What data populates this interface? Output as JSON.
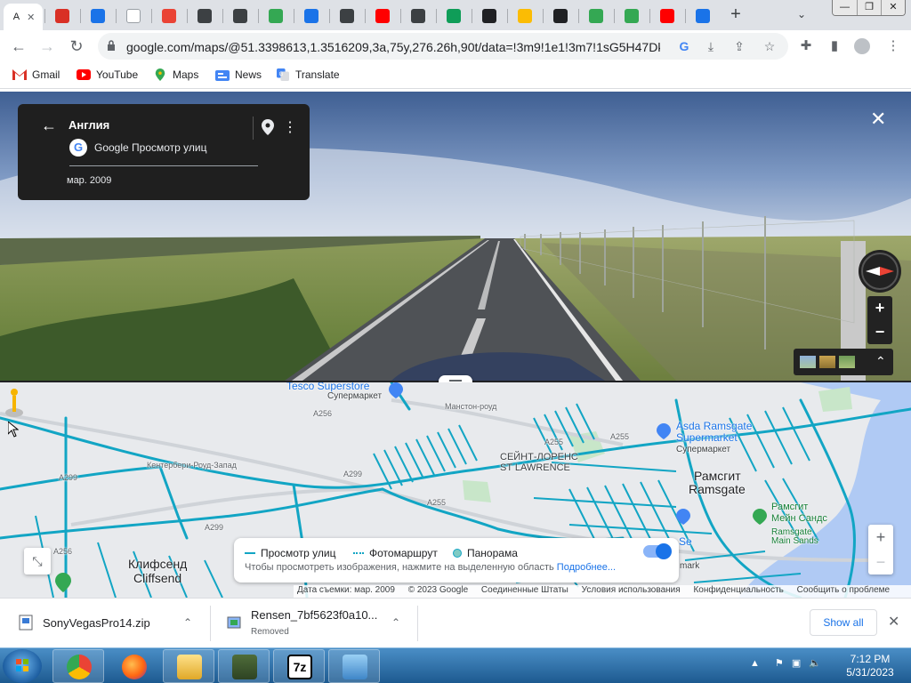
{
  "browser": {
    "tabs": [
      {
        "icon": "maps-icon",
        "color": "#ffffff",
        "active": true
      },
      {
        "icon": "gmail-icon",
        "color": "#d93025"
      },
      {
        "icon": "download-icon",
        "color": "#1a73e8"
      },
      {
        "icon": "google-icon",
        "color": "#ffffff"
      },
      {
        "icon": "download-red-icon",
        "color": "#ea4335"
      },
      {
        "icon": "github-icon",
        "color": "#3c4043"
      },
      {
        "icon": "github-icon",
        "color": "#3c4043"
      },
      {
        "icon": "share-icon",
        "color": "#34a853"
      },
      {
        "icon": "upload-icon",
        "color": "#1a73e8"
      },
      {
        "icon": "chrome-icon",
        "color": "#3c4043"
      },
      {
        "icon": "youtube-icon",
        "color": "#ff0000"
      },
      {
        "icon": "handshake-icon",
        "color": "#3c4043"
      },
      {
        "icon": "sheets-icon",
        "color": "#0f9d58"
      },
      {
        "icon": "e-icon",
        "color": "#202124"
      },
      {
        "icon": "pencil-icon",
        "color": "#fbbc04"
      },
      {
        "icon": "g-dark-icon",
        "color": "#202124"
      },
      {
        "icon": "drive-icon",
        "color": "#34a853"
      },
      {
        "icon": "drive-icon",
        "color": "#34a853"
      },
      {
        "icon": "youtube-icon",
        "color": "#ff0000"
      },
      {
        "icon": "loading-icon",
        "color": "#1a73e8"
      }
    ],
    "active_tab_title": "A",
    "url": "google.com/maps/@51.3398613,1.3516209,3a,75y,276.26h,90t/data=!3m9!1e1!3m7!1sG5H47Dk...",
    "bookmarks": [
      {
        "label": "Gmail",
        "icon": "gmail-icon"
      },
      {
        "label": "YouTube",
        "icon": "youtube-icon"
      },
      {
        "label": "Maps",
        "icon": "maps-icon"
      },
      {
        "label": "News",
        "icon": "news-icon"
      },
      {
        "label": "Translate",
        "icon": "translate-icon"
      }
    ]
  },
  "streetview": {
    "title": "Англия",
    "source": "Google Просмотр улиц",
    "date": "мар. 2009"
  },
  "map": {
    "labels": {
      "tesco": "Tesco Superstore",
      "tesco_sub": "Супермаркет",
      "manston": "Манстон-роуд",
      "a256_top": "A256",
      "canterbury": "Кентербери-Роуд-Запад",
      "a299_left": "A299",
      "a299_mid": "A299",
      "a299_low": "A299",
      "a256_left": "A256",
      "a255_a": "A255",
      "a255_b": "A255",
      "a255_c": "A255",
      "stlaw_ru": "СЕЙНТ-ЛОРЕНС",
      "stlaw_en": "ST LAWRENCE",
      "asda": "Asda Ramsgate",
      "asda_2": "Supermarket",
      "asda_sub": "Супермаркет",
      "ramsgate_ru": "Рамсгит",
      "ramsgate_en": "Ramsgate",
      "sands_ru": "Рамсгит",
      "sands_ru2": "Мейн Сандс",
      "sands_en": "Ramsgate",
      "sands_en2": "Main Sands",
      "cliffsend_ru": "Клифсенд",
      "cliffsend_en": "Cliffsend",
      "se": "Se",
      "mark": "mark"
    },
    "layers": {
      "street_view": "Просмотр улиц",
      "photo_route": "Фотомаршрут",
      "panorama": "Панорама",
      "hint": "Чтобы просмотреть изображения, нажмите на выделенную область",
      "more": "Подробнее..."
    },
    "attribution": [
      "Дата съемки: мар. 2009",
      "© 2023 Google",
      "Соединенные Штаты",
      "Условия использования",
      "Конфиденциальность",
      "Сообщить о проблеме"
    ]
  },
  "downloads": [
    {
      "name": "SonyVegasPro14.zip",
      "status": ""
    },
    {
      "name": "Rensen_7bf5623f0a10...",
      "status": "Removed"
    }
  ],
  "downloads_show_all": "Show all",
  "taskbar": {
    "time": "7:12 PM",
    "date": "5/31/2023"
  },
  "colors": {
    "road_overlay": "#12a5c4",
    "accent": "#1a73e8"
  }
}
